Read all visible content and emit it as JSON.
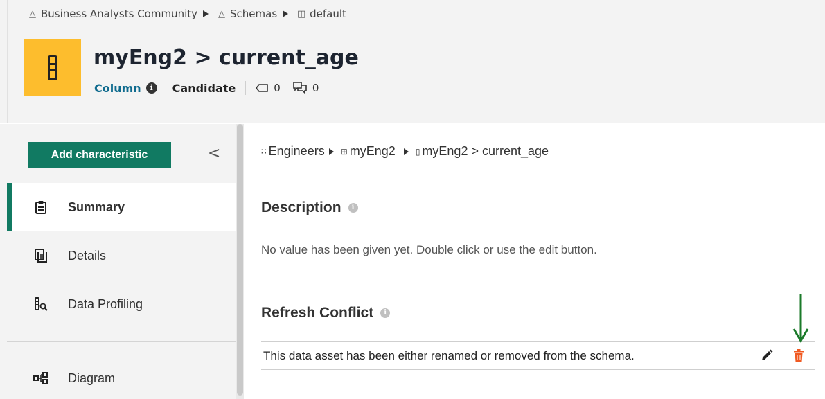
{
  "breadcrumb": {
    "community": "Business Analysts Community",
    "schemas": "Schemas",
    "default": "default"
  },
  "asset": {
    "title": "myEng2 > current_age",
    "type": "Column",
    "status": "Candidate",
    "tags_count": "0",
    "comments_count": "0",
    "tile_color": "#fdbd2d"
  },
  "sidebar": {
    "add_button": "Add characteristic",
    "collapse_glyph": "<",
    "items": [
      {
        "label": "Summary",
        "icon": "clipboard-icon",
        "active": true
      },
      {
        "label": "Details",
        "icon": "document-icon",
        "active": false
      },
      {
        "label": "Data Profiling",
        "icon": "column-search-icon",
        "active": false
      },
      {
        "label": "Diagram",
        "icon": "diagram-icon",
        "active": false
      }
    ]
  },
  "main": {
    "crumbs": {
      "engineers": "Engineers",
      "table": "myEng2",
      "column": "myEng2 > current_age"
    },
    "description_title": "Description",
    "description_text": "No value has been given yet. Double click or use the edit button.",
    "conflict_title": "Refresh Conflict",
    "conflict_text": "This data asset has been either renamed or removed from the schema."
  },
  "colors": {
    "accent": "#117a62",
    "type_link": "#0f6b8e",
    "delete": "#f05a22",
    "arrow": "#1b7a2a"
  }
}
